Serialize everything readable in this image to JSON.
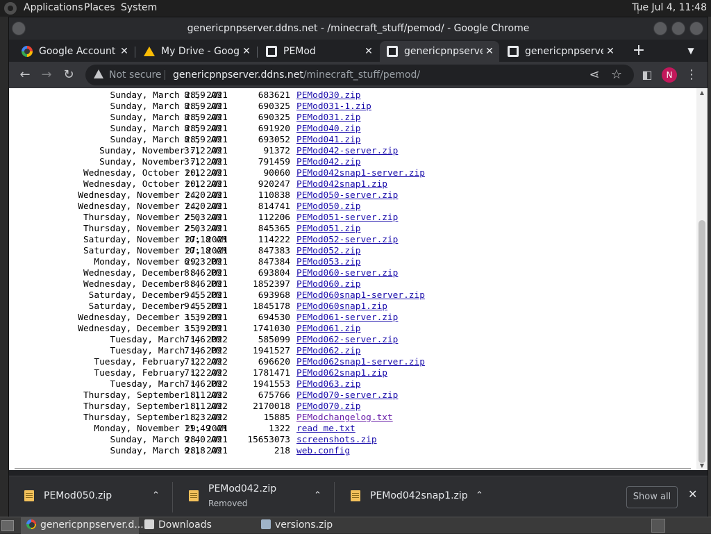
{
  "topbar": {
    "menus": [
      "Applications",
      "Places",
      "System"
    ],
    "clock": "Tue Jul  4, 11:48"
  },
  "window": {
    "title": "genericpnpserver.ddns.net - /minecraft_stuff/pemod/ - Google Chrome"
  },
  "tabs": [
    {
      "label": "Google Account",
      "icon": "google-icon"
    },
    {
      "label": "My Drive - Google Drive",
      "icon": "drive-icon"
    },
    {
      "label": "PEMod",
      "icon": "pemod-icon"
    },
    {
      "label": "genericpnpserver.ddns.net",
      "icon": "pemod-icon",
      "active": true
    },
    {
      "label": "genericpnpserver.ddns.net",
      "icon": "pemod-icon"
    }
  ],
  "toolbar": {
    "security": "Not secure",
    "url_host": "genericpnpserver.ddns.net",
    "url_path": "/minecraft_stuff/pemod/",
    "profile_initial": "N"
  },
  "listing": [
    {
      "date": "Sunday, March 28, 2021",
      "time": "8:59 AM",
      "size": "683621",
      "name": "PEMod030.zip"
    },
    {
      "date": "Sunday, March 28, 2021",
      "time": "8:59 AM",
      "size": "690325",
      "name": "PEMod031-1.zip"
    },
    {
      "date": "Sunday, March 28, 2021",
      "time": "8:59 AM",
      "size": "690325",
      "name": "PEMod031.zip"
    },
    {
      "date": "Sunday, March 28, 2021",
      "time": "8:59 AM",
      "size": "691920",
      "name": "PEMod040.zip"
    },
    {
      "date": "Sunday, March 28, 2021",
      "time": "8:59 AM",
      "size": "693052",
      "name": "PEMod041.zip"
    },
    {
      "date": "Sunday, November 7, 2021",
      "time": "3:12 AM",
      "size": "91372",
      "name": "PEMod042-server.zip"
    },
    {
      "date": "Sunday, November 7, 2021",
      "time": "3:12 AM",
      "size": "791459",
      "name": "PEMod042.zip"
    },
    {
      "date": "Wednesday, October 20, 2021",
      "time": "1:12 AM",
      "size": "90060",
      "name": "PEMod042snap1-server.zip"
    },
    {
      "date": "Wednesday, October 20, 2021",
      "time": "1:12 AM",
      "size": "920247",
      "name": "PEMod042snap1.zip"
    },
    {
      "date": "Wednesday, November 24, 2021",
      "time": "7:20 AM",
      "size": "110838",
      "name": "PEMod050-server.zip"
    },
    {
      "date": "Wednesday, November 24, 2021",
      "time": "7:20 AM",
      "size": "814741",
      "name": "PEMod050.zip"
    },
    {
      "date": "Thursday, November 25, 2021",
      "time": "2:03 AM",
      "size": "112206",
      "name": "PEMod051-server.zip"
    },
    {
      "date": "Thursday, November 25, 2021",
      "time": "2:03 AM",
      "size": "845365",
      "name": "PEMod051.zip"
    },
    {
      "date": "Saturday, November 27, 2021",
      "time": "10:18 AM",
      "size": "114222",
      "name": "PEMod052-server.zip"
    },
    {
      "date": "Saturday, November 27, 2021",
      "time": "10:18 AM",
      "size": "847383",
      "name": "PEMod052.zip"
    },
    {
      "date": "Monday, November 29, 2021",
      "time": "6:23 PM",
      "size": "847384",
      "name": "PEMod053.zip"
    },
    {
      "date": "Wednesday, December 8, 2021",
      "time": "8:46 PM",
      "size": "693804",
      "name": "PEMod060-server.zip"
    },
    {
      "date": "Wednesday, December 8, 2021",
      "time": "8:46 PM",
      "size": "1852397",
      "name": "PEMod060.zip"
    },
    {
      "date": "Saturday, December 4, 2021",
      "time": "9:55 PM",
      "size": "693968",
      "name": "PEMod060snap1-server.zip"
    },
    {
      "date": "Saturday, December 4, 2021",
      "time": "9:55 PM",
      "size": "1845178",
      "name": "PEMod060snap1.zip"
    },
    {
      "date": "Wednesday, December 15, 2021",
      "time": "3:39 PM",
      "size": "694530",
      "name": "PEMod061-server.zip"
    },
    {
      "date": "Wednesday, December 15, 2021",
      "time": "3:39 PM",
      "size": "1741030",
      "name": "PEMod061.zip"
    },
    {
      "date": "Tuesday, March 1, 2022",
      "time": "7:46 PM",
      "size": "585099",
      "name": "PEMod062-server.zip"
    },
    {
      "date": "Tuesday, March 1, 2022",
      "time": "7:46 PM",
      "size": "1941527",
      "name": "PEMod062.zip"
    },
    {
      "date": "Tuesday, February 1, 2022",
      "time": "7:22 AM",
      "size": "696620",
      "name": "PEMod062snap1-server.zip"
    },
    {
      "date": "Tuesday, February 1, 2022",
      "time": "7:22 AM",
      "size": "1781471",
      "name": "PEMod062snap1.zip"
    },
    {
      "date": "Tuesday, March 1, 2022",
      "time": "7:46 PM",
      "size": "1941553",
      "name": "PEMod063.zip"
    },
    {
      "date": "Thursday, September 8, 2022",
      "time": "1:11 AM",
      "size": "675766",
      "name": "PEMod070-server.zip"
    },
    {
      "date": "Thursday, September 8, 2022",
      "time": "1:11 AM",
      "size": "2170018",
      "name": "PEMod070.zip"
    },
    {
      "date": "Thursday, September 8, 2022",
      "time": "1:23 AM",
      "size": "15885",
      "name": "PEModchangelog.txt",
      "visited": true
    },
    {
      "date": "Monday, November 29, 2021",
      "time": "11:49 AM",
      "size": "1322",
      "name": "read me.txt"
    },
    {
      "date": "Sunday, March 28, 2021",
      "time": "9:40 AM",
      "size": "15653073",
      "name": "screenshots.zip"
    },
    {
      "date": "Sunday, March 28, 2021",
      "time": "9:18 AM",
      "size": "218",
      "name": "web.config"
    }
  ],
  "downloads": [
    {
      "name": "PEMod050.zip",
      "status": ""
    },
    {
      "name": "PEMod042.zip",
      "status": "Removed"
    },
    {
      "name": "PEMod042snap1.zip",
      "status": ""
    }
  ],
  "shelf": {
    "show_all": "Show all"
  },
  "taskbar": [
    {
      "label": "genericpnpserver.d...",
      "icon": "chrome-icon",
      "active": true
    },
    {
      "label": "Downloads",
      "icon": "folder-icon"
    },
    {
      "label": "versions.zip",
      "icon": "archive-icon"
    }
  ]
}
